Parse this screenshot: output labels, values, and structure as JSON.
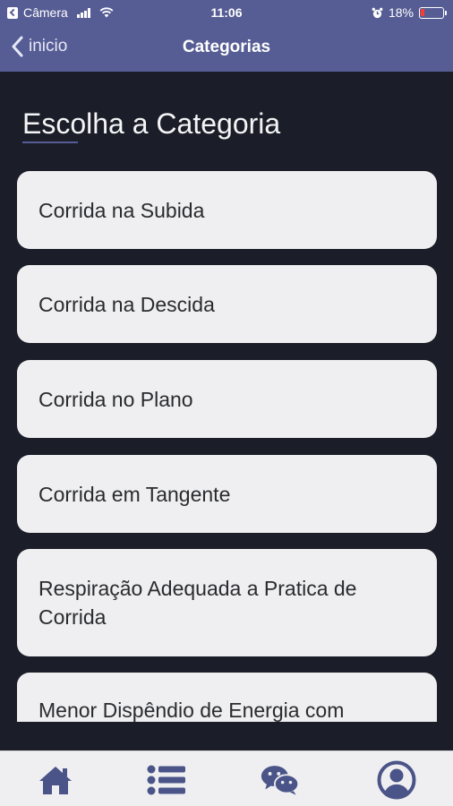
{
  "status_bar": {
    "carrier": "Câmera",
    "time": "11:06",
    "battery": "18%"
  },
  "nav": {
    "back_label": "inicio",
    "title": "Categorias"
  },
  "main": {
    "heading": "Escolha a Categoria",
    "categories": [
      {
        "label": "Corrida na Subida"
      },
      {
        "label": "Corrida na Descida"
      },
      {
        "label": "Corrida no Plano"
      },
      {
        "label": "Corrida em Tangente"
      },
      {
        "label": "Respiração Adequada a Pratica de Corrida"
      },
      {
        "label": "Menor Dispêndio de Energia com"
      }
    ]
  },
  "tab_bar": {
    "items": [
      {
        "icon": "home-icon"
      },
      {
        "icon": "list-icon"
      },
      {
        "icon": "chat-icon"
      },
      {
        "icon": "user-icon"
      }
    ]
  },
  "colors": {
    "accent": "#565d94",
    "background": "#1b1e28",
    "card": "#efeff1",
    "tab_icon": "#4a5488",
    "battery_low": "#ff3b30"
  }
}
